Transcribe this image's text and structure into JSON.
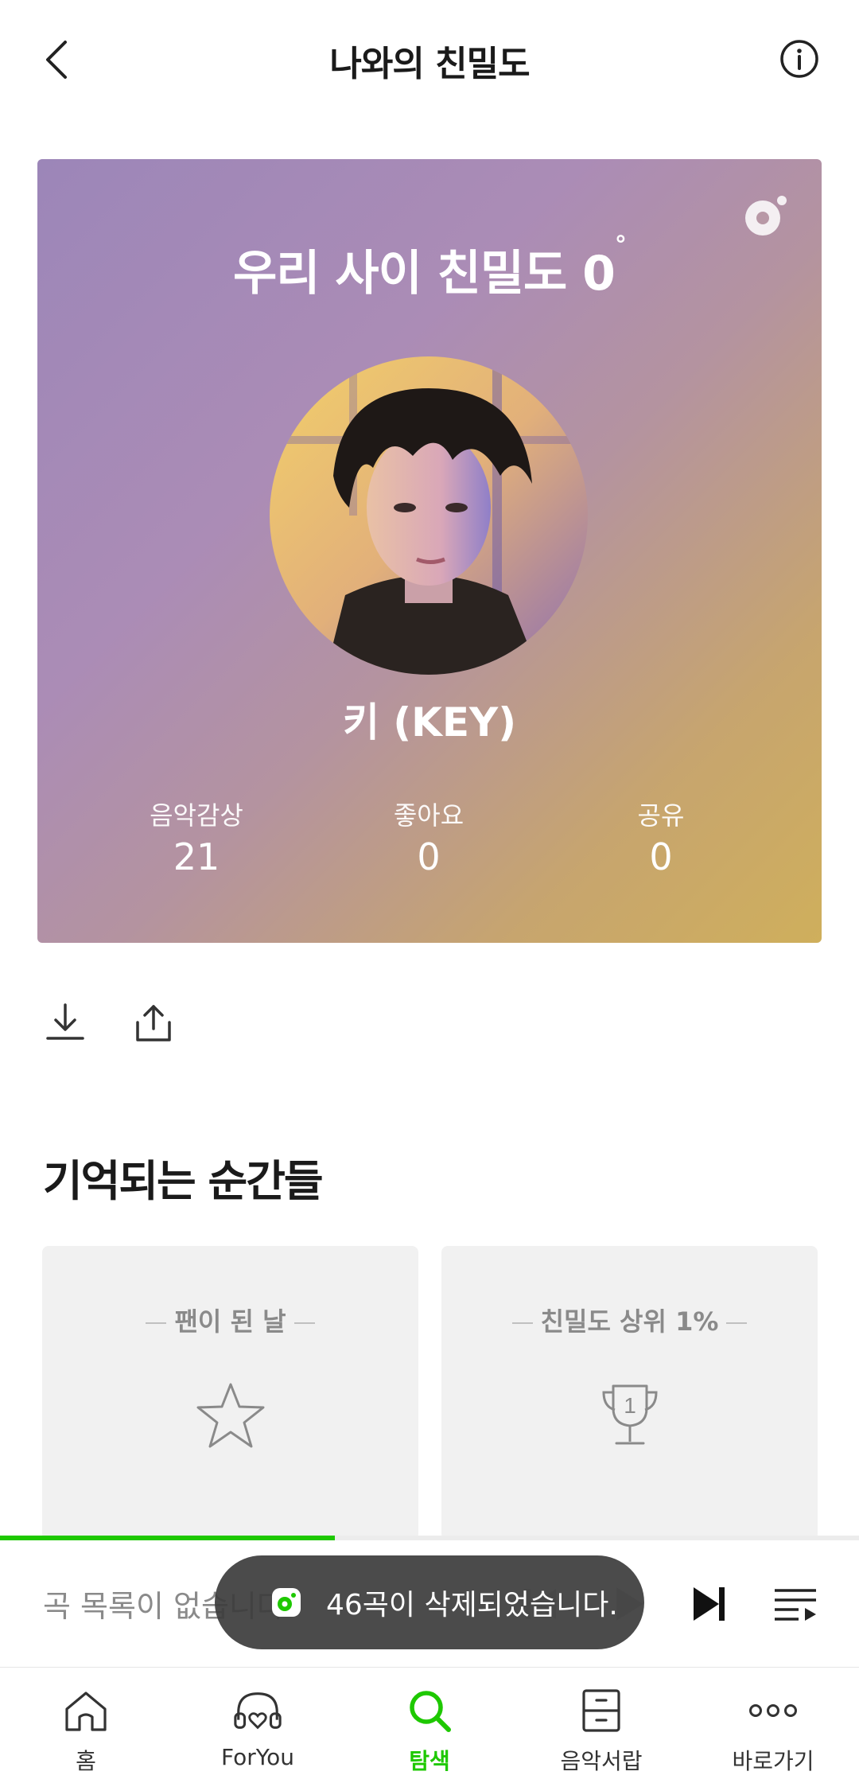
{
  "header": {
    "title": "나와의 친밀도",
    "back_icon": "chevron-left-icon",
    "info_icon": "info-icon"
  },
  "card": {
    "title": "우리 사이 친밀도 0",
    "degree": "°",
    "artist_name": "키 (KEY)",
    "stats": [
      {
        "label": "음악감상",
        "value": "21"
      },
      {
        "label": "좋아요",
        "value": "0"
      },
      {
        "label": "공유",
        "value": "0"
      }
    ]
  },
  "actions": {
    "download_icon": "download-icon",
    "share_icon": "share-icon"
  },
  "moments": {
    "title": "기억되는 순간들",
    "items": [
      {
        "label": "팬이 된 날",
        "icon": "star-icon"
      },
      {
        "label": "친밀도 상위 1%",
        "icon": "trophy-icon"
      }
    ]
  },
  "player": {
    "empty_text": "곡 목록이 없습니다",
    "progress": 0.39
  },
  "toast": {
    "message": "46곡이 삭제되었습니다."
  },
  "nav": {
    "items": [
      {
        "label": "홈",
        "icon": "home-icon",
        "active": false
      },
      {
        "label": "ForYou",
        "icon": "headphones-icon",
        "active": false
      },
      {
        "label": "탐색",
        "icon": "search-icon",
        "active": true
      },
      {
        "label": "음악서랍",
        "icon": "drawer-icon",
        "active": false
      },
      {
        "label": "바로가기",
        "icon": "more-icon",
        "active": false
      }
    ]
  },
  "colors": {
    "accent": "#1ec800",
    "toast_bg": "#3c3c3c"
  }
}
